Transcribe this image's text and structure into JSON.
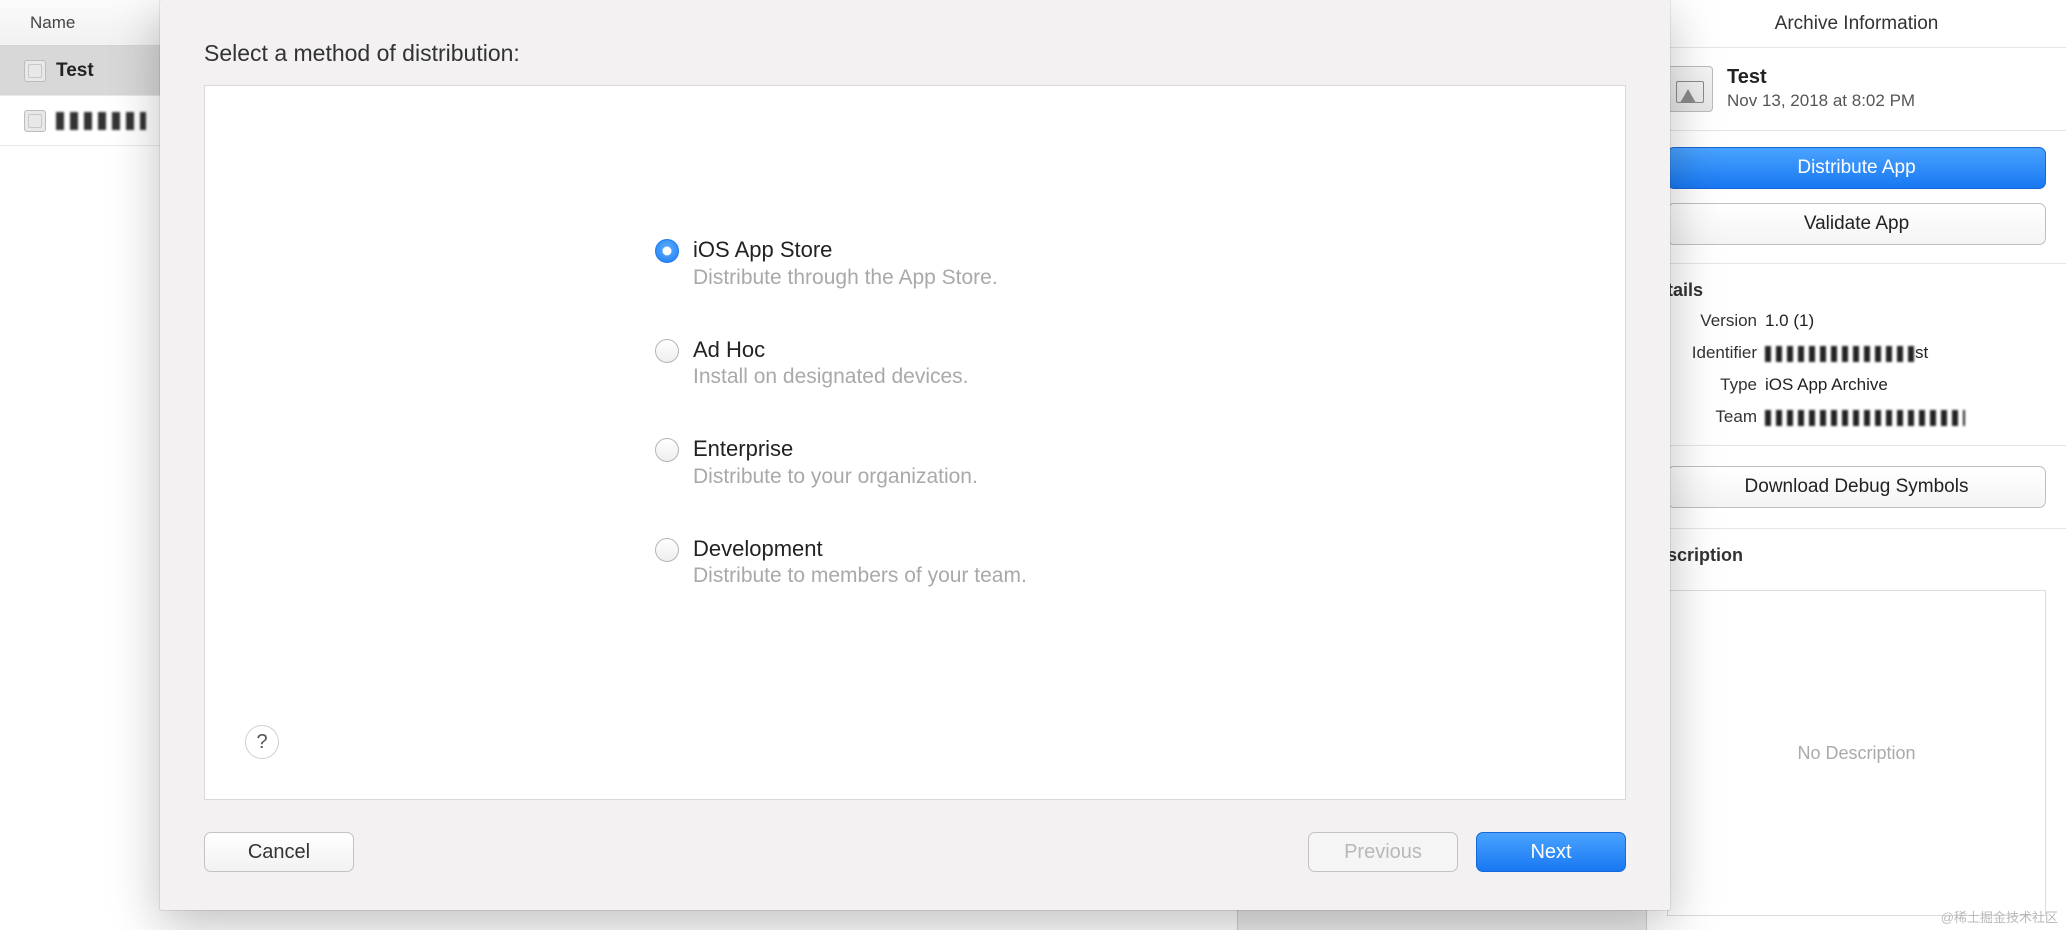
{
  "left": {
    "header": "Name",
    "archives": [
      {
        "name": "Test",
        "selected": true
      },
      {
        "name": "[redacted]",
        "selected": false
      }
    ]
  },
  "modal": {
    "heading": "Select a method of distribution:",
    "options": [
      {
        "label": "iOS App Store",
        "desc": "Distribute through the App Store.",
        "checked": true
      },
      {
        "label": "Ad Hoc",
        "desc": "Install on designated devices.",
        "checked": false
      },
      {
        "label": "Enterprise",
        "desc": "Distribute to your organization.",
        "checked": false
      },
      {
        "label": "Development",
        "desc": "Distribute to members of your team.",
        "checked": false
      }
    ],
    "help": "?",
    "buttons": {
      "cancel": "Cancel",
      "previous": "Previous",
      "next": "Next"
    }
  },
  "right": {
    "title": "Archive Information",
    "archiveName": "Test",
    "archiveDate": "Nov 13, 2018 at 8:02 PM",
    "distribute": "Distribute App",
    "validate": "Validate App",
    "detailsHeader": "etails",
    "details": {
      "versionKey": "Version",
      "versionVal": "1.0 (1)",
      "identifierKey": "Identifier",
      "identifierVal": "st",
      "typeKey": "Type",
      "typeVal": "iOS App Archive",
      "teamKey": "Team",
      "teamVal": ""
    },
    "downloadSymbols": "Download Debug Symbols",
    "descriptionHeader": "escription",
    "noDescription": "No Description"
  },
  "watermark": "@稀土掘金技术社区"
}
